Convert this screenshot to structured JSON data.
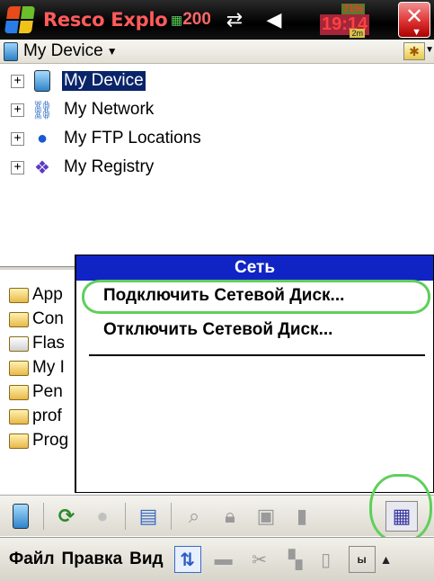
{
  "titlebar": {
    "app_title": "Resco Explo",
    "title_overflow": "200",
    "battery_percent": "71%",
    "clock": "19:14",
    "memory": "2m",
    "close_label": "✕"
  },
  "pathbar": {
    "location": "My Device"
  },
  "tree": {
    "items": [
      {
        "label": "My Device",
        "icon": "device-icon"
      },
      {
        "label": "My Network",
        "icon": "network-icon"
      },
      {
        "label": "My FTP Locations",
        "icon": "ftp-globe-icon"
      },
      {
        "label": "My Registry",
        "icon": "registry-icon"
      }
    ]
  },
  "files": [
    {
      "label": "App",
      "icon": "folder-icon"
    },
    {
      "label": "Con",
      "icon": "folder-icon"
    },
    {
      "label": "Flas",
      "icon": "storage-card-icon"
    },
    {
      "label": "My I",
      "icon": "folder-icon"
    },
    {
      "label": "Pen",
      "icon": "folder-icon"
    },
    {
      "label": "prof",
      "icon": "folder-icon"
    },
    {
      "label": "Prog",
      "icon": "folder-icon"
    }
  ],
  "context_menu": {
    "title": "Сеть",
    "items": [
      "Подключить Сетевой Диск...",
      "Отключить Сетевой Диск..."
    ]
  },
  "menubar": {
    "file": "Файл",
    "edit": "Правка",
    "view": "Вид",
    "kbd": "ы"
  },
  "colors": {
    "menu_header": "#1024c6",
    "selection": "#0a246a",
    "highlight_annotation": "#5fcf5a",
    "title_text": "#ff5b5b"
  }
}
